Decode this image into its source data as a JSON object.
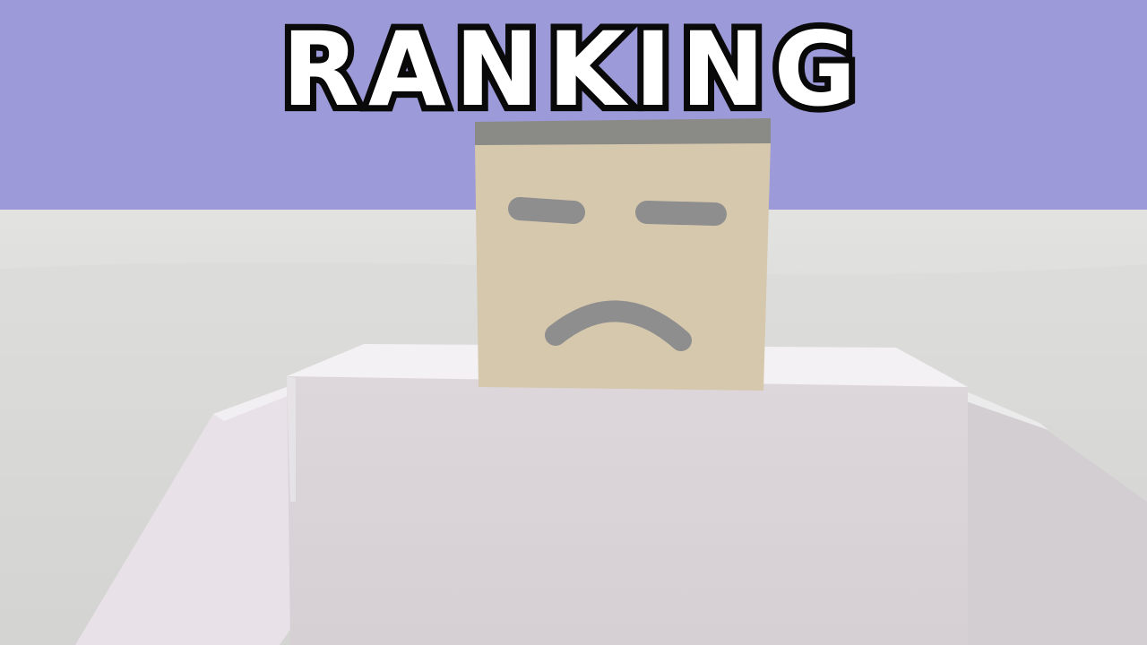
{
  "screen": {
    "title": "RANKING"
  },
  "colors": {
    "sky": "#9c9ad8",
    "ground": "#dcdcdc",
    "head_skin": "#d6c8ad",
    "head_hair": "#8a8a86",
    "face_features": "#8e8e8e",
    "body": "#dcd6da",
    "title_fill": "#ffffff",
    "title_outline": "#0a0a0a"
  },
  "character": {
    "expression": "sad"
  }
}
